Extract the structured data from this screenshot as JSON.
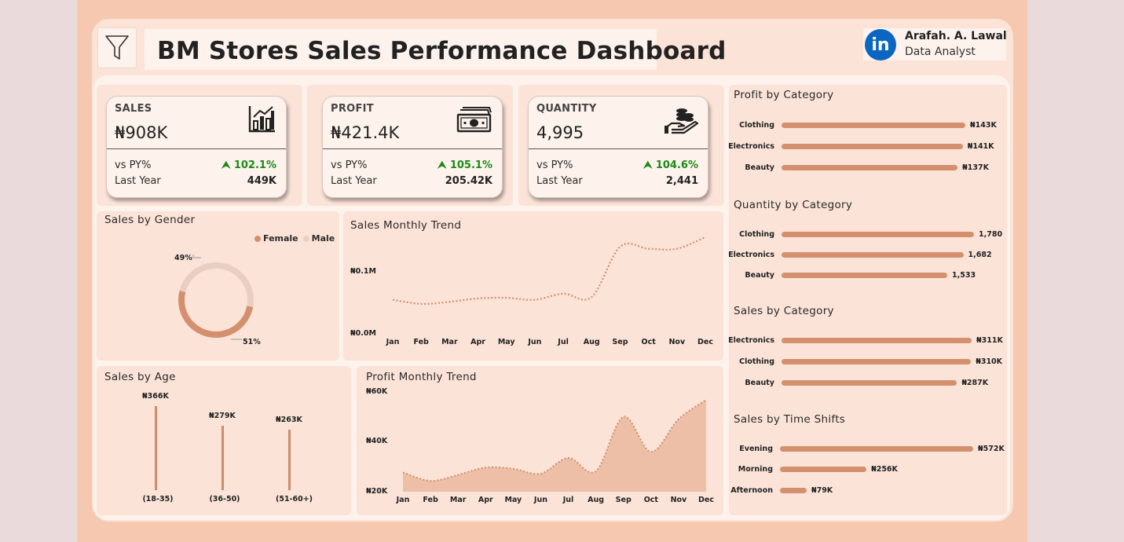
{
  "header": {
    "title": "BM Stores Sales Performance Dashboard",
    "filter_icon": "filter-icon"
  },
  "profile": {
    "name": "Arafah. A. Lawal",
    "role": "Data Analyst",
    "logo_text": "in",
    "logo_icon": "linkedin-icon"
  },
  "kpis": [
    {
      "label": "SALES",
      "value": "₦908K",
      "vs_label": "vs PY%",
      "vs_value": "102.1%",
      "ly_label": "Last Year",
      "ly_value": "449K",
      "icon": "bar-chart-icon"
    },
    {
      "label": "PROFIT",
      "value": "₦421.4K",
      "vs_label": "vs PY%",
      "vs_value": "105.1%",
      "ly_label": "Last Year",
      "ly_value": "205.42K",
      "icon": "cash-icon"
    },
    {
      "label": "QUANTITY",
      "value": "4,995",
      "vs_label": "vs PY%",
      "vs_value": "104.6%",
      "ly_label": "Last Year",
      "ly_value": "2,441",
      "icon": "coins-hand-icon"
    }
  ],
  "colors": {
    "accent": "#d4906e",
    "male": "#e8cfc2",
    "positive": "#1a8a1a"
  },
  "gender": {
    "title": "Sales by Gender",
    "legend": [
      "Female",
      "Male"
    ],
    "female_label": "51%",
    "male_label": "49%",
    "female_share": 0.51,
    "male_share": 0.49
  },
  "sales_trend": {
    "title": "Sales Monthly Trend",
    "y_ticks": [
      "₦0.1M",
      "₦0.0M"
    ]
  },
  "profit_trend": {
    "title": "Profit Monthly Trend",
    "y_ticks": [
      "₦60K",
      "₦40K",
      "₦20K"
    ]
  },
  "age": {
    "title": "Sales by Age"
  },
  "categories_panels": {
    "profit_title": "Profit by Category",
    "quantity_title": "Quantity by Category",
    "sales_title": "Sales by Category",
    "shifts_title": "Sales by Time Shifts"
  },
  "chart_data": [
    {
      "type": "pie",
      "title": "Sales by Gender",
      "categories": [
        "Female",
        "Male"
      ],
      "values": [
        51,
        49
      ]
    },
    {
      "type": "line",
      "title": "Sales Monthly Trend",
      "categories": [
        "Jan",
        "Feb",
        "Mar",
        "Apr",
        "May",
        "Jun",
        "Jul",
        "Aug",
        "Sep",
        "Oct",
        "Nov",
        "Dec"
      ],
      "values": [
        50000,
        44000,
        47000,
        52000,
        53000,
        50000,
        59000,
        54000,
        128000,
        125000,
        125000,
        142000
      ],
      "ylim": [
        0,
        150000
      ],
      "y_ticks": [
        "₦0.1M",
        "₦0.0M"
      ]
    },
    {
      "type": "area",
      "title": "Profit Monthly Trend",
      "categories": [
        "Jan",
        "Feb",
        "Mar",
        "Apr",
        "May",
        "Jun",
        "Jul",
        "Aug",
        "Sep",
        "Oct",
        "Nov",
        "Dec"
      ],
      "values": [
        28000,
        24500,
        27000,
        30000,
        29500,
        27500,
        34000,
        28500,
        51000,
        36500,
        50000,
        58000
      ],
      "ylim": [
        20000,
        60000
      ],
      "y_ticks": [
        "₦60K",
        "₦40K",
        "₦20K"
      ]
    },
    {
      "type": "bar",
      "title": "Sales by Age",
      "categories": [
        "(18-35)",
        "(36-50)",
        "(51-60+)"
      ],
      "values": [
        366000,
        279000,
        263000
      ],
      "labels": [
        "₦366K",
        "₦279K",
        "₦263K"
      ]
    },
    {
      "type": "bar",
      "title": "Profit by Category",
      "categories": [
        "Clothing",
        "Electronics",
        "Beauty"
      ],
      "values": [
        143000,
        141000,
        137000
      ],
      "labels": [
        "₦143K",
        "₦141K",
        "₦137K"
      ]
    },
    {
      "type": "bar",
      "title": "Quantity by Category",
      "categories": [
        "Clothing",
        "Electronics",
        "Beauty"
      ],
      "values": [
        1780,
        1682,
        1533
      ],
      "labels": [
        "1,780",
        "1,682",
        "1,533"
      ]
    },
    {
      "type": "bar",
      "title": "Sales by Category",
      "categories": [
        "Electronics",
        "Clothing",
        "Beauty"
      ],
      "values": [
        311000,
        310000,
        287000
      ],
      "labels": [
        "₦311K",
        "₦310K",
        "₦287K"
      ]
    },
    {
      "type": "bar",
      "title": "Sales by Time Shifts",
      "categories": [
        "Evening",
        "Morning",
        "Afternoon"
      ],
      "values": [
        572000,
        256000,
        79000
      ],
      "labels": [
        "₦572K",
        "₦256K",
        "₦79K"
      ]
    }
  ]
}
